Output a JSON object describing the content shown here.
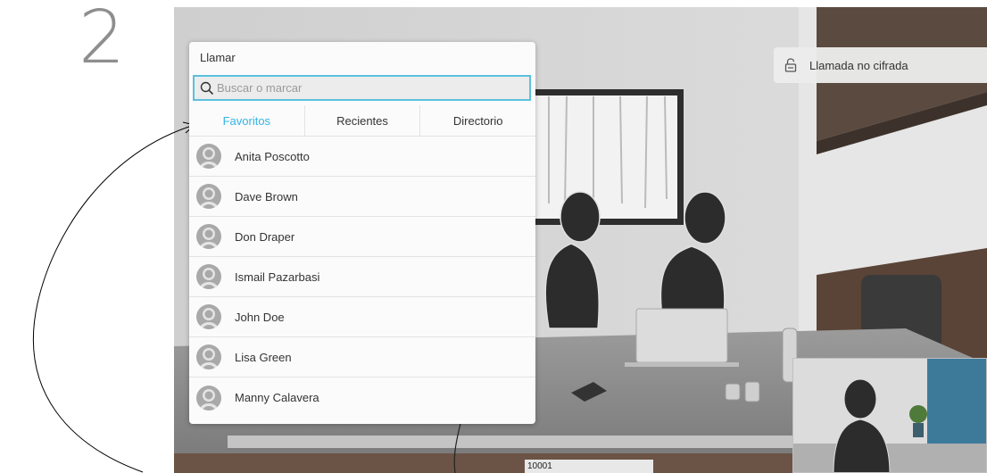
{
  "step": {
    "number": "2"
  },
  "call_panel": {
    "title": "Llamar",
    "search": {
      "placeholder": "Buscar o marcar",
      "value": "",
      "icon": "search-icon"
    },
    "tabs": [
      {
        "label": "Favoritos",
        "active": true
      },
      {
        "label": "Recientes",
        "active": false
      },
      {
        "label": "Directorio",
        "active": false
      }
    ],
    "contacts": [
      {
        "name": "Anita Poscotto"
      },
      {
        "name": "Dave Brown"
      },
      {
        "name": "Don Draper"
      },
      {
        "name": "Ismail Pazarbasi"
      },
      {
        "name": "John Doe"
      },
      {
        "name": "Lisa Green"
      },
      {
        "name": "Manny Calavera"
      }
    ]
  },
  "security": {
    "label": "Llamada no cifrada",
    "icon": "unlocked-padlock-icon"
  },
  "self_view": {
    "label": "10001"
  },
  "colors": {
    "accent": "#33b5e5",
    "search_border": "#5bc0de",
    "step_number": "#8e8e8e"
  }
}
